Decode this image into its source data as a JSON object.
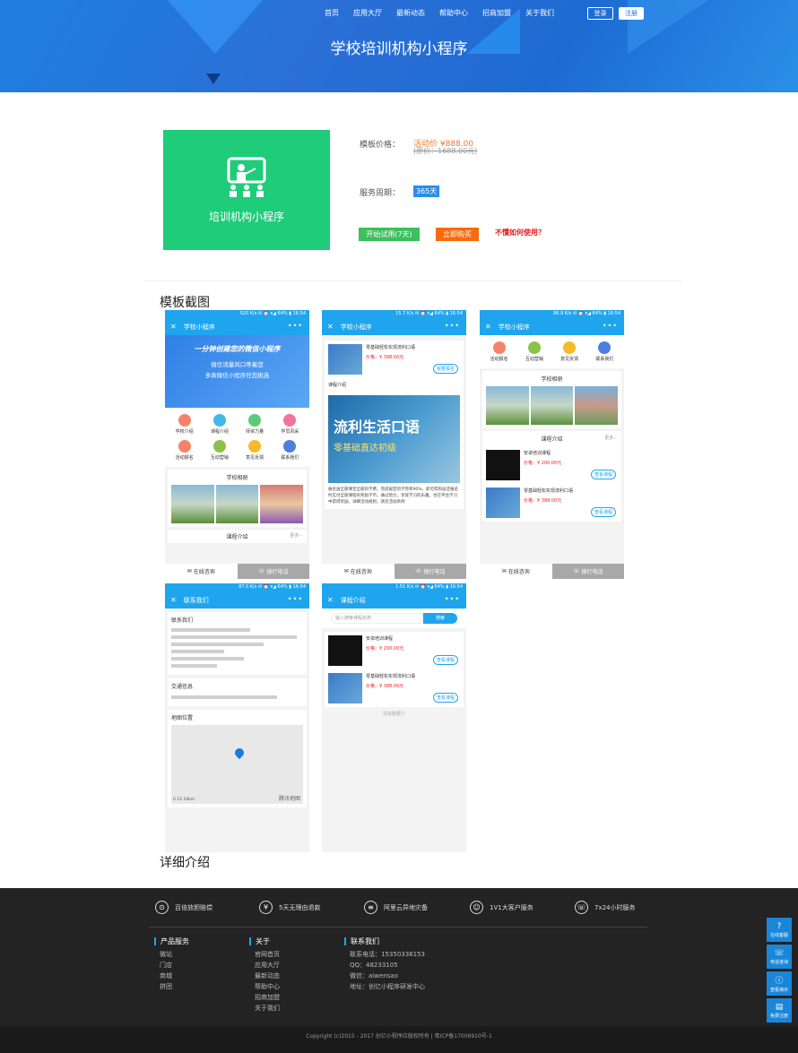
{
  "nav": {
    "items": [
      "首页",
      "应用大厅",
      "最新动态",
      "帮助中心",
      "招商加盟",
      "关于我们"
    ],
    "login": "登录",
    "register": "注册"
  },
  "hero": {
    "title": "学校培训机构小程序"
  },
  "product": {
    "card_label": "培训机构小程序",
    "price_label": "模板价格：",
    "price_active": "活动价 ¥888.00",
    "price_orig": "(原价：1688.00元)",
    "period_label": "服务周期：",
    "period_value": "365天",
    "try_button": "开始试用(7天)",
    "buy_button": "立即购买",
    "howto_link": "不懂如何使用？"
  },
  "sections": {
    "screenshots": "模板截图",
    "details": "详细介绍"
  },
  "phones": {
    "status1": "520 K/s  ✉ ⏰ ▾◢ 64% ▮ 16:54",
    "status2": "15.7 K/s  ✉ ⏰ ▾◢ 64% ▮ 16:54",
    "status3": "86.9 K/s  ✉ ⏰ ▾◢ 64% ▮ 16:54",
    "status4": "87.0 K/s  ✉ ⏰ ▾◢ 64% ▮ 16:54",
    "status5": "1.51 K/s  ✉ ⏰ ▾◢ 64% ▮ 16:54",
    "title_main": "学校小程序",
    "title_contact": "联系我们",
    "title_course": "课程介绍",
    "banner_line1": "一分钟创建您的微信小程序",
    "banner_line2": "微信流量风口等着您",
    "banner_line3": "多款微信小程序任您挑选",
    "grid": [
      "学校介绍",
      "课程介绍",
      "师资力量",
      "学员风采",
      "活动报名",
      "互动营销",
      "意见反馈",
      "联系我们"
    ],
    "grid_short": [
      "活动报名",
      "互动营销",
      "意见反馈",
      "联系我们"
    ],
    "album": "学校相册",
    "course_intro": "课程介绍",
    "more": "更多···",
    "online": "在线咨询",
    "call": "拨打电话",
    "course1_name": "安卓培训课程",
    "course2_name": "零基础轻松实现流利口语",
    "course1_price": "价格：¥ 200.00元",
    "course2_price": "价格：¥ 388.00元",
    "view_course": "查看课程",
    "enroll": "我要报名",
    "course_desc_title": "课程介绍",
    "poster_line1": "流利生活口语",
    "poster_line2": "零基础直达初级",
    "course_desc": "报名送全部课堂全部的学费。完成规定的学完率90%，即可得到返还报名时实付全部课程的奖励学币。通过努力，享受学习的乐趣，也在平台学习中获得奖励。详细活动规则，请见活动条例",
    "contact_head": "联系我们",
    "traffic_head": "交通信息",
    "map_head": "地图位置",
    "map_brand": "腾讯地图",
    "map_scale": "0    12    24km",
    "search_placeholder": "输入搜索课程名称",
    "search_btn": "搜索",
    "no_more": "没有数据了"
  },
  "footer": {
    "features": [
      "百倍放胆赔偿",
      "5天无理由退款",
      "阿里云异地灾备",
      "1V1大客户服务",
      "7x24小时服务"
    ],
    "col1": {
      "title": "产品服务",
      "items": [
        "微站",
        "门店",
        "商城",
        "拼团"
      ]
    },
    "col2": {
      "title": "关于",
      "items": [
        "官网首页",
        "应用大厅",
        "最新动态",
        "帮助中心",
        "招商加盟",
        "关于我们"
      ]
    },
    "col3": {
      "title": "联系我们",
      "items": [
        "联系电话：15350338153",
        "QQ：48233105",
        "微信：aiwensao",
        "地址：创亿小程序研发中心"
      ]
    },
    "copyright": "Copyright (c)2015 - 2017 创亿小程序应版权所有 | 粤ICP备17006910号-1"
  },
  "side": [
    "在线客服",
    "电话咨询",
    "查看演示",
    "免费注册"
  ]
}
